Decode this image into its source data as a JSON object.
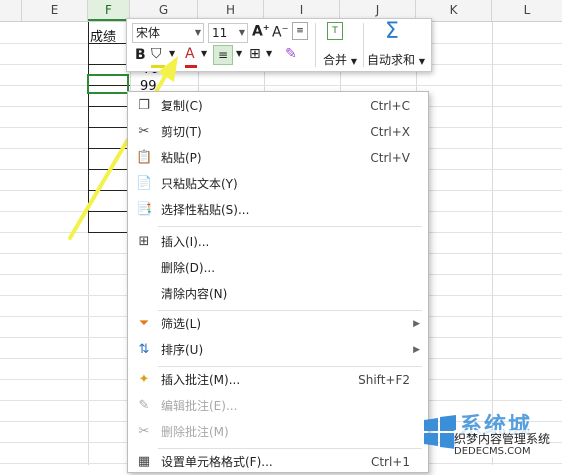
{
  "columns": [
    "E",
    "F",
    "G",
    "H",
    "I",
    "J",
    "K",
    "L"
  ],
  "cells": {
    "f1": "成绩",
    "f3": "79",
    "f4": "99"
  },
  "mini_toolbar": {
    "font_name": "宋体",
    "font_size": "11",
    "bold": "B",
    "font_color_glyph": "A",
    "merge_label": "合并",
    "autosum_label": "自动求和",
    "autosum_glyph": "Σ"
  },
  "context_menu": {
    "items": [
      {
        "label": "复制(C)",
        "shortcut": "Ctrl+C",
        "icon": "copy-icon"
      },
      {
        "label": "剪切(T)",
        "shortcut": "Ctrl+X",
        "icon": "scissors-icon"
      },
      {
        "label": "粘贴(P)",
        "shortcut": "Ctrl+V",
        "icon": "paste-icon"
      },
      {
        "label": "只粘贴文本(Y)",
        "shortcut": "",
        "icon": "paste-text-icon"
      },
      {
        "label": "选择性粘贴(S)...",
        "shortcut": "",
        "icon": "paste-special-icon"
      },
      {
        "label": "插入(I)...",
        "shortcut": "",
        "icon": "insert-icon"
      },
      {
        "label": "删除(D)...",
        "shortcut": "",
        "icon": ""
      },
      {
        "label": "清除内容(N)",
        "shortcut": "",
        "icon": ""
      },
      {
        "label": "筛选(L)",
        "shortcut": "",
        "icon": "filter-icon"
      },
      {
        "label": "排序(U)",
        "shortcut": "",
        "icon": "sort-icon"
      },
      {
        "label": "插入批注(M)...",
        "shortcut": "Shift+F2",
        "icon": "insert-comment-icon"
      },
      {
        "label": "编辑批注(E)...",
        "shortcut": "",
        "icon": "edit-comment-icon"
      },
      {
        "label": "删除批注(M)",
        "shortcut": "",
        "icon": "delete-comment-icon"
      },
      {
        "label": "设置单元格格式(F)...",
        "shortcut": "Ctrl+1",
        "icon": "format-cells-icon"
      }
    ]
  },
  "watermark": {
    "brand": "系统城",
    "line1": "织梦内容管理系统",
    "line2": "DEDECMS.COM"
  },
  "colors": {
    "accent": "#2a8a36",
    "highlight_arrow": "#f2f24a"
  }
}
